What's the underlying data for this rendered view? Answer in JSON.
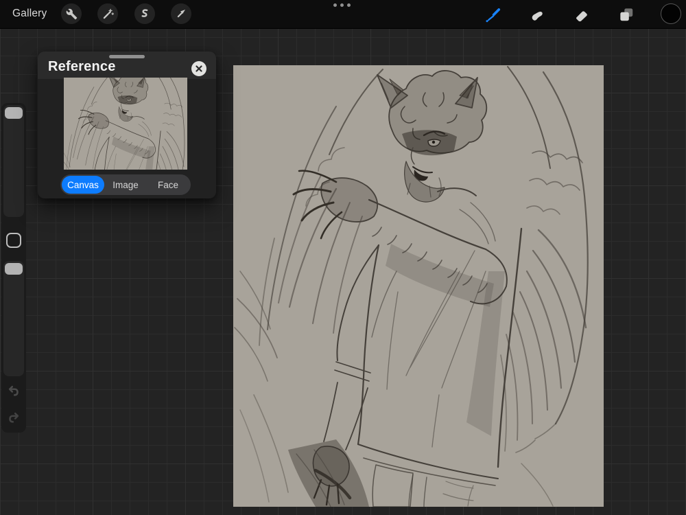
{
  "topbar": {
    "gallery_label": "Gallery",
    "left_tools": [
      {
        "name": "actions",
        "icon": "wrench-icon"
      },
      {
        "name": "adjustments",
        "icon": "magic-wand-icon"
      },
      {
        "name": "selection",
        "icon": "selection-s-icon"
      },
      {
        "name": "transform",
        "icon": "transform-arrow-icon"
      }
    ],
    "center_menu_icon": "ellipsis-icon",
    "right_tools": [
      {
        "name": "brush",
        "icon": "paintbrush-icon",
        "active": true,
        "active_color": "#1982f8"
      },
      {
        "name": "smudge",
        "icon": "smudge-finger-icon",
        "active": false
      },
      {
        "name": "erase",
        "icon": "eraser-icon",
        "active": false
      },
      {
        "name": "layers",
        "icon": "layers-icon",
        "active": false
      },
      {
        "name": "color",
        "icon": "color-swatch",
        "current_color": "#000000"
      }
    ]
  },
  "sidebar": {
    "sliders": [
      {
        "name": "brush-size",
        "handle_position": "top"
      },
      {
        "name": "brush-opacity",
        "handle_position": "top"
      }
    ],
    "modify_button_icon": "rounded-square-icon",
    "undo_icon": "undo-arrow-icon",
    "redo_icon": "redo-arrow-icon"
  },
  "reference_panel": {
    "title": "Reference",
    "close_icon": "close-x-icon",
    "drag_handle_icon": "drag-handle",
    "thumbnail": "reference-thumbnail-sketch",
    "tabs": [
      {
        "label": "Canvas",
        "active": true
      },
      {
        "label": "Image",
        "active": false
      },
      {
        "label": "Face",
        "active": false
      }
    ],
    "active_tab_color": "#0d7cfe"
  },
  "canvas": {
    "description": "graphite sketch of a winged werewolf man raising a clawed arm to his mouth",
    "background_color": "#a8a39a"
  },
  "colors": {
    "topbar_bg": "#0d0d0d",
    "workspace_bg": "#232323",
    "grid_line": "#2c2c2c",
    "sidebar_bg": "#1b1b1b",
    "panel_header_bg": "#2b2b2b",
    "panel_body_bg": "#212121",
    "accent_blue": "#0d7cfe",
    "brush_active_blue": "#1982f8"
  }
}
